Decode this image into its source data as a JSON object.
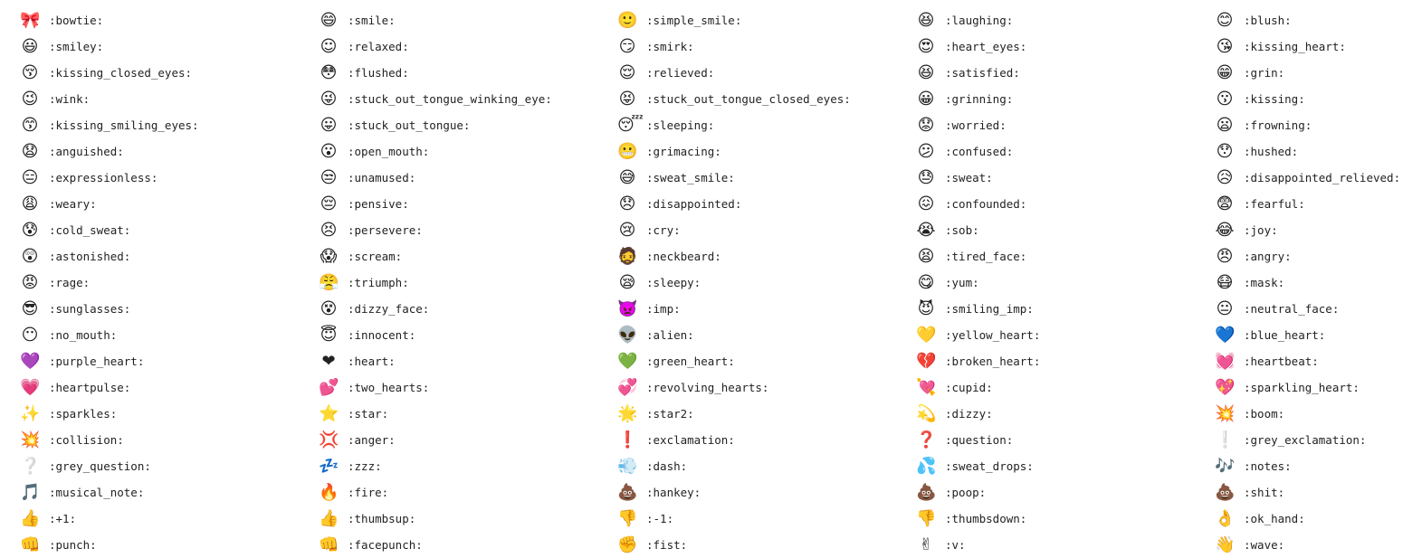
{
  "emojis": [
    {
      "icon": "bowtie-icon",
      "glyph": "🎀",
      "code": ":bowtie:"
    },
    {
      "icon": "smile-icon",
      "glyph": "😄",
      "code": ":smile:"
    },
    {
      "icon": "simple-smile-icon",
      "glyph": "🙂",
      "code": ":simple_smile:"
    },
    {
      "icon": "laughing-icon",
      "glyph": "😆",
      "code": ":laughing:"
    },
    {
      "icon": "blush-icon",
      "glyph": "😊",
      "code": ":blush:"
    },
    {
      "icon": "smiley-icon",
      "glyph": "😃",
      "code": ":smiley:"
    },
    {
      "icon": "relaxed-icon",
      "glyph": "☺",
      "code": ":relaxed:"
    },
    {
      "icon": "smirk-icon",
      "glyph": "😏",
      "code": ":smirk:"
    },
    {
      "icon": "heart-eyes-icon",
      "glyph": "😍",
      "code": ":heart_eyes:"
    },
    {
      "icon": "kissing-heart-icon",
      "glyph": "😘",
      "code": ":kissing_heart:"
    },
    {
      "icon": "kissing-closed-eyes-icon",
      "glyph": "😚",
      "code": ":kissing_closed_eyes:"
    },
    {
      "icon": "flushed-icon",
      "glyph": "😳",
      "code": ":flushed:"
    },
    {
      "icon": "relieved-icon",
      "glyph": "😌",
      "code": ":relieved:"
    },
    {
      "icon": "satisfied-icon",
      "glyph": "😆",
      "code": ":satisfied:"
    },
    {
      "icon": "grin-icon",
      "glyph": "😁",
      "code": ":grin:"
    },
    {
      "icon": "wink-icon",
      "glyph": "😉",
      "code": ":wink:"
    },
    {
      "icon": "stuck-out-tongue-winking-eye-icon",
      "glyph": "😜",
      "code": ":stuck_out_tongue_winking_eye:"
    },
    {
      "icon": "stuck-out-tongue-closed-eyes-icon",
      "glyph": "😝",
      "code": ":stuck_out_tongue_closed_eyes:"
    },
    {
      "icon": "grinning-icon",
      "glyph": "😀",
      "code": ":grinning:"
    },
    {
      "icon": "kissing-icon",
      "glyph": "😗",
      "code": ":kissing:"
    },
    {
      "icon": "kissing-smiling-eyes-icon",
      "glyph": "😙",
      "code": ":kissing_smiling_eyes:"
    },
    {
      "icon": "stuck-out-tongue-icon",
      "glyph": "😛",
      "code": ":stuck_out_tongue:"
    },
    {
      "icon": "sleeping-icon",
      "glyph": "😴",
      "code": ":sleeping:"
    },
    {
      "icon": "worried-icon",
      "glyph": "😟",
      "code": ":worried:"
    },
    {
      "icon": "frowning-icon",
      "glyph": "😦",
      "code": ":frowning:"
    },
    {
      "icon": "anguished-icon",
      "glyph": "😧",
      "code": ":anguished:"
    },
    {
      "icon": "open-mouth-icon",
      "glyph": "😮",
      "code": ":open_mouth:"
    },
    {
      "icon": "grimacing-icon",
      "glyph": "😬",
      "code": ":grimacing:"
    },
    {
      "icon": "confused-icon",
      "glyph": "😕",
      "code": ":confused:"
    },
    {
      "icon": "hushed-icon",
      "glyph": "😯",
      "code": ":hushed:"
    },
    {
      "icon": "expressionless-icon",
      "glyph": "😑",
      "code": ":expressionless:"
    },
    {
      "icon": "unamused-icon",
      "glyph": "😒",
      "code": ":unamused:"
    },
    {
      "icon": "sweat-smile-icon",
      "glyph": "😅",
      "code": ":sweat_smile:"
    },
    {
      "icon": "sweat-icon",
      "glyph": "😓",
      "code": ":sweat:"
    },
    {
      "icon": "disappointed-relieved-icon",
      "glyph": "😥",
      "code": ":disappointed_relieved:"
    },
    {
      "icon": "weary-icon",
      "glyph": "😩",
      "code": ":weary:"
    },
    {
      "icon": "pensive-icon",
      "glyph": "😔",
      "code": ":pensive:"
    },
    {
      "icon": "disappointed-icon",
      "glyph": "😞",
      "code": ":disappointed:"
    },
    {
      "icon": "confounded-icon",
      "glyph": "😖",
      "code": ":confounded:"
    },
    {
      "icon": "fearful-icon",
      "glyph": "😨",
      "code": ":fearful:"
    },
    {
      "icon": "cold-sweat-icon",
      "glyph": "😰",
      "code": ":cold_sweat:"
    },
    {
      "icon": "persevere-icon",
      "glyph": "😣",
      "code": ":persevere:"
    },
    {
      "icon": "cry-icon",
      "glyph": "😢",
      "code": ":cry:"
    },
    {
      "icon": "sob-icon",
      "glyph": "😭",
      "code": ":sob:"
    },
    {
      "icon": "joy-icon",
      "glyph": "😂",
      "code": ":joy:"
    },
    {
      "icon": "astonished-icon",
      "glyph": "😲",
      "code": ":astonished:"
    },
    {
      "icon": "scream-icon",
      "glyph": "😱",
      "code": ":scream:"
    },
    {
      "icon": "neckbeard-icon",
      "glyph": "🧔",
      "code": ":neckbeard:"
    },
    {
      "icon": "tired-face-icon",
      "glyph": "😫",
      "code": ":tired_face:"
    },
    {
      "icon": "angry-icon",
      "glyph": "😠",
      "code": ":angry:"
    },
    {
      "icon": "rage-icon",
      "glyph": "😡",
      "code": ":rage:"
    },
    {
      "icon": "triumph-icon",
      "glyph": "😤",
      "code": ":triumph:"
    },
    {
      "icon": "sleepy-icon",
      "glyph": "😪",
      "code": ":sleepy:"
    },
    {
      "icon": "yum-icon",
      "glyph": "😋",
      "code": ":yum:"
    },
    {
      "icon": "mask-icon",
      "glyph": "😷",
      "code": ":mask:"
    },
    {
      "icon": "sunglasses-icon",
      "glyph": "😎",
      "code": ":sunglasses:"
    },
    {
      "icon": "dizzy-face-icon",
      "glyph": "😵",
      "code": ":dizzy_face:"
    },
    {
      "icon": "imp-icon",
      "glyph": "👿",
      "code": ":imp:"
    },
    {
      "icon": "smiling-imp-icon",
      "glyph": "😈",
      "code": ":smiling_imp:"
    },
    {
      "icon": "neutral-face-icon",
      "glyph": "😐",
      "code": ":neutral_face:"
    },
    {
      "icon": "no-mouth-icon",
      "glyph": "😶",
      "code": ":no_mouth:"
    },
    {
      "icon": "innocent-icon",
      "glyph": "😇",
      "code": ":innocent:"
    },
    {
      "icon": "alien-icon",
      "glyph": "👽",
      "code": ":alien:"
    },
    {
      "icon": "yellow-heart-icon",
      "glyph": "💛",
      "code": ":yellow_heart:"
    },
    {
      "icon": "blue-heart-icon",
      "glyph": "💙",
      "code": ":blue_heart:"
    },
    {
      "icon": "purple-heart-icon",
      "glyph": "💜",
      "code": ":purple_heart:"
    },
    {
      "icon": "heart-icon",
      "glyph": "❤",
      "code": ":heart:"
    },
    {
      "icon": "green-heart-icon",
      "glyph": "💚",
      "code": ":green_heart:"
    },
    {
      "icon": "broken-heart-icon",
      "glyph": "💔",
      "code": ":broken_heart:"
    },
    {
      "icon": "heartbeat-icon",
      "glyph": "💓",
      "code": ":heartbeat:"
    },
    {
      "icon": "heartpulse-icon",
      "glyph": "💗",
      "code": ":heartpulse:"
    },
    {
      "icon": "two-hearts-icon",
      "glyph": "💕",
      "code": ":two_hearts:"
    },
    {
      "icon": "revolving-hearts-icon",
      "glyph": "💞",
      "code": ":revolving_hearts:"
    },
    {
      "icon": "cupid-icon",
      "glyph": "💘",
      "code": ":cupid:"
    },
    {
      "icon": "sparkling-heart-icon",
      "glyph": "💖",
      "code": ":sparkling_heart:"
    },
    {
      "icon": "sparkles-icon",
      "glyph": "✨",
      "code": ":sparkles:"
    },
    {
      "icon": "star-icon",
      "glyph": "⭐",
      "code": ":star:"
    },
    {
      "icon": "star2-icon",
      "glyph": "🌟",
      "code": ":star2:"
    },
    {
      "icon": "dizzy-icon",
      "glyph": "💫",
      "code": ":dizzy:"
    },
    {
      "icon": "boom-icon",
      "glyph": "💥",
      "code": ":boom:"
    },
    {
      "icon": "collision-icon",
      "glyph": "💥",
      "code": ":collision:"
    },
    {
      "icon": "anger-icon",
      "glyph": "💢",
      "code": ":anger:"
    },
    {
      "icon": "exclamation-icon",
      "glyph": "❗",
      "code": ":exclamation:"
    },
    {
      "icon": "question-icon",
      "glyph": "❓",
      "code": ":question:"
    },
    {
      "icon": "grey-exclamation-icon",
      "glyph": "❕",
      "code": ":grey_exclamation:"
    },
    {
      "icon": "grey-question-icon",
      "glyph": "❔",
      "code": ":grey_question:"
    },
    {
      "icon": "zzz-icon",
      "glyph": "💤",
      "code": ":zzz:"
    },
    {
      "icon": "dash-icon",
      "glyph": "💨",
      "code": ":dash:"
    },
    {
      "icon": "sweat-drops-icon",
      "glyph": "💦",
      "code": ":sweat_drops:"
    },
    {
      "icon": "notes-icon",
      "glyph": "🎶",
      "code": ":notes:"
    },
    {
      "icon": "musical-note-icon",
      "glyph": "🎵",
      "code": ":musical_note:"
    },
    {
      "icon": "fire-icon",
      "glyph": "🔥",
      "code": ":fire:"
    },
    {
      "icon": "hankey-icon",
      "glyph": "💩",
      "code": ":hankey:"
    },
    {
      "icon": "poop-icon",
      "glyph": "💩",
      "code": ":poop:"
    },
    {
      "icon": "shit-icon",
      "glyph": "💩",
      "code": ":shit:"
    },
    {
      "icon": "plus-one-icon",
      "glyph": "👍",
      "code": ":+1:"
    },
    {
      "icon": "thumbsup-icon",
      "glyph": "👍",
      "code": ":thumbsup:"
    },
    {
      "icon": "minus-one-icon",
      "glyph": "👎",
      "code": ":-1:"
    },
    {
      "icon": "thumbsdown-icon",
      "glyph": "👎",
      "code": ":thumbsdown:"
    },
    {
      "icon": "ok-hand-icon",
      "glyph": "👌",
      "code": ":ok_hand:"
    },
    {
      "icon": "punch-icon",
      "glyph": "👊",
      "code": ":punch:"
    },
    {
      "icon": "facepunch-icon",
      "glyph": "👊",
      "code": ":facepunch:"
    },
    {
      "icon": "fist-icon",
      "glyph": "✊",
      "code": ":fist:"
    },
    {
      "icon": "v-icon",
      "glyph": "✌",
      "code": ":v:"
    },
    {
      "icon": "wave-icon",
      "glyph": "👋",
      "code": ":wave:"
    }
  ]
}
